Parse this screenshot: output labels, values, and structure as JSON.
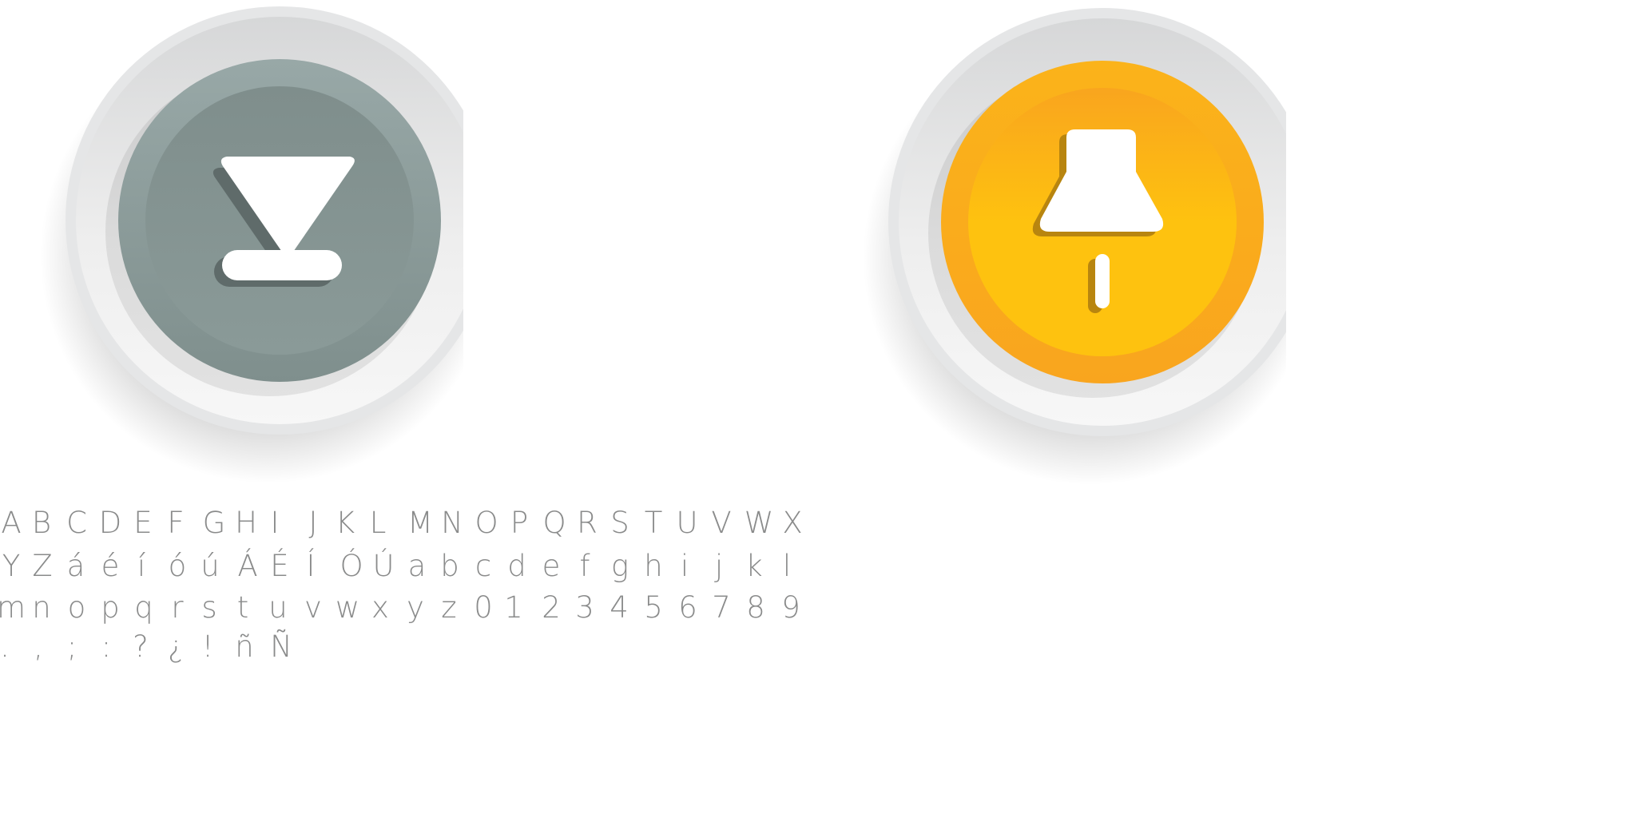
{
  "buttons": [
    {
      "name": "eject-button",
      "icon": "eject-down-icon",
      "colors": {
        "ring_light": "#f1f1f1",
        "ring_dark": "#d2d3d4",
        "face_outer": "#93a3a2",
        "face_inner": "#7f8e8c",
        "shadow": "#5f6b6a",
        "glyph": "#ffffff"
      }
    },
    {
      "name": "pin-button",
      "icon": "push-pin-icon",
      "colors": {
        "ring_light": "#f1f1f1",
        "ring_dark": "#d2d3d4",
        "face_outer": "#fec20f",
        "face_inner": "#f9a51e",
        "shadow": "#b8850f",
        "glyph": "#ffffff"
      }
    }
  ],
  "specimen": {
    "color": "#8a8b8b",
    "lines": [
      [
        "A",
        "B",
        "C",
        "D",
        "E",
        "F",
        "G",
        "H",
        "I",
        "J",
        "K",
        "L",
        "M",
        "N",
        "O",
        "P",
        "Q",
        "R",
        "S",
        "T",
        "U",
        "V",
        "W",
        "X"
      ],
      [
        "Y",
        "Z",
        "á",
        "é",
        "í",
        "ó",
        "ú",
        "Á",
        "É",
        "Í",
        "Ó",
        "Ú",
        "a",
        "b",
        "c",
        "d",
        "e",
        "f",
        "g",
        "h",
        "i",
        "j",
        "k",
        "l"
      ],
      [
        "m",
        "n",
        "o",
        "p",
        "q",
        "r",
        "s",
        "t",
        "u",
        "v",
        "w",
        "x",
        "y",
        "z",
        "0",
        "1",
        "2",
        "3",
        "4",
        "5",
        "6",
        "7",
        "8",
        "9"
      ],
      [
        ".",
        ",",
        ";",
        ":",
        "?",
        "¿",
        "!",
        "ñ",
        "Ñ"
      ]
    ]
  }
}
